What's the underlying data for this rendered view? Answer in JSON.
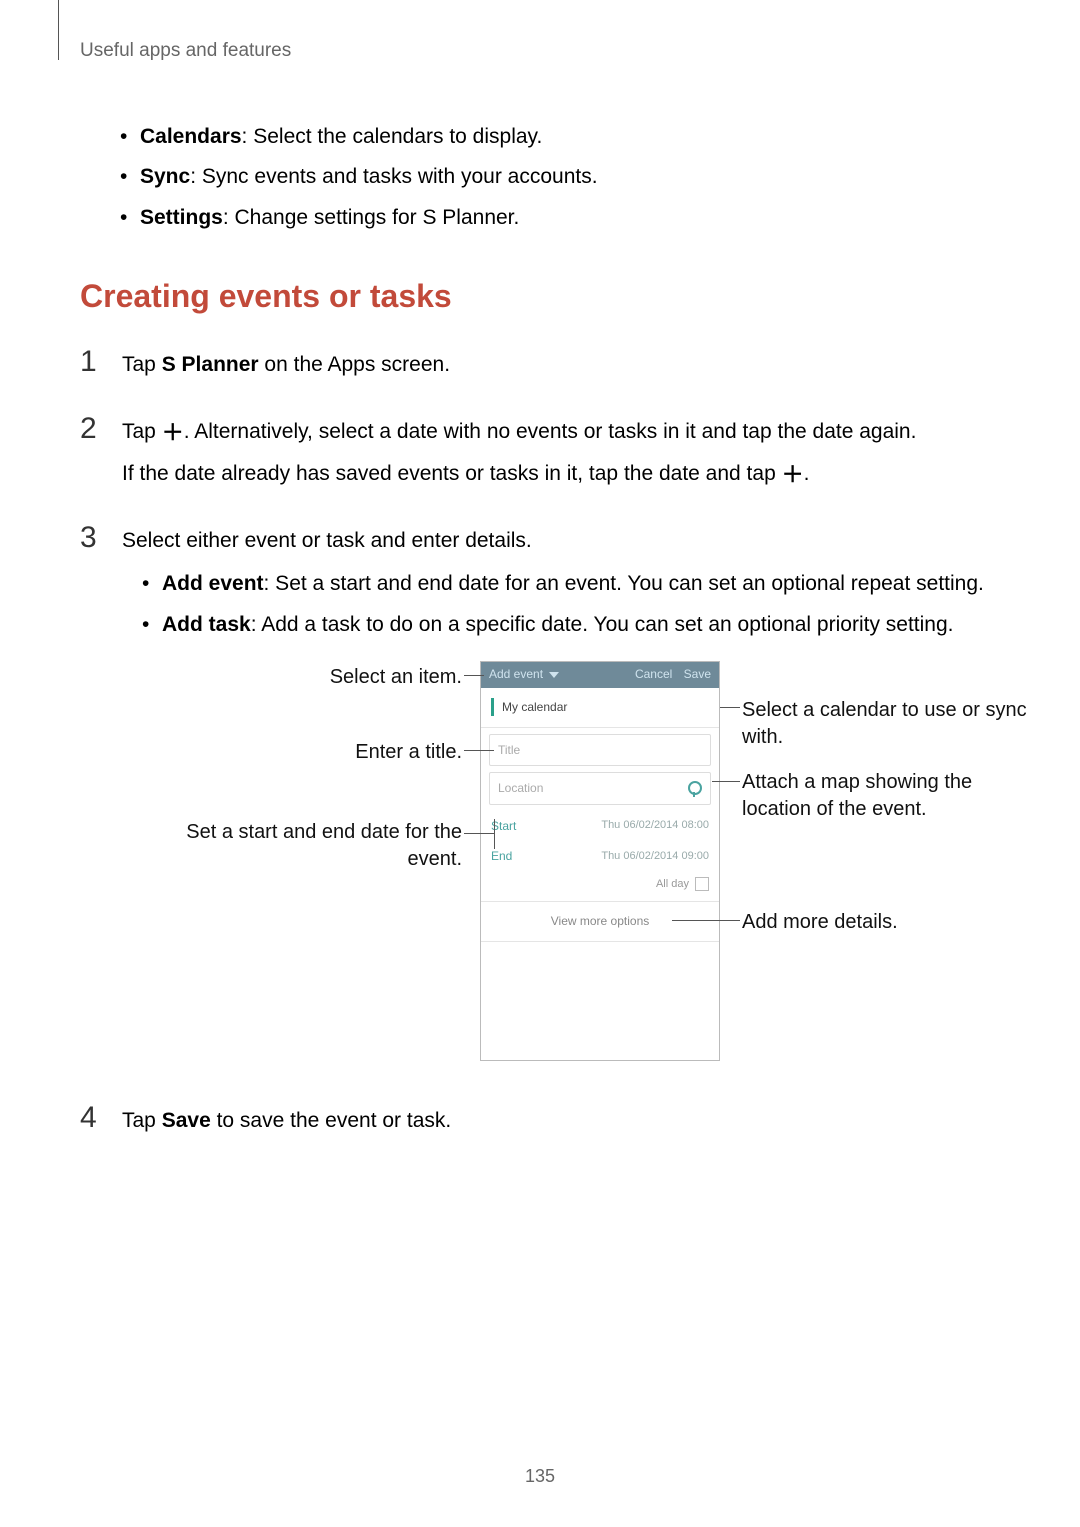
{
  "header": {
    "breadcrumb": "Useful apps and features"
  },
  "bullets_top": [
    {
      "term": "Calendars",
      "desc": ": Select the calendars to display."
    },
    {
      "term": "Sync",
      "desc": ": Sync events and tasks with your accounts."
    },
    {
      "term": "Settings",
      "desc": ": Change settings for S Planner."
    }
  ],
  "h2": "Creating events or tasks",
  "steps": {
    "s1": {
      "num": "1",
      "pre": "Tap ",
      "bold": "S Planner",
      "post": " on the Apps screen."
    },
    "s2": {
      "num": "2",
      "line1a": "Tap ",
      "line1b": ". Alternatively, select a date with no events or tasks in it and tap the date again.",
      "line2a": "If the date already has saved events or tasks in it, tap the date and tap ",
      "line2b": "."
    },
    "s3": {
      "num": "3",
      "intro": "Select either event or task and enter details.",
      "b1_term": "Add event",
      "b1_desc": ": Set a start and end date for an event. You can set an optional repeat setting.",
      "b2_term": "Add task",
      "b2_desc": ": Add a task to do on a specific date. You can set an optional priority setting."
    },
    "s4": {
      "num": "4",
      "pre": "Tap ",
      "bold": "Save",
      "post": " to save the event or task."
    }
  },
  "callouts": {
    "select_item": "Select an item.",
    "enter_title": "Enter a title.",
    "set_dates": "Set a start and end date for the event.",
    "select_calendar": "Select a calendar to use or sync with.",
    "attach_map": "Attach a map showing the location of the event.",
    "add_more": "Add more details."
  },
  "phone": {
    "header_left": "Add event",
    "header_cancel": "Cancel",
    "header_save": "Save",
    "my_calendar": "My calendar",
    "title_placeholder": "Title",
    "location_placeholder": "Location",
    "start_label": "Start",
    "start_value": "Thu 06/02/2014   08:00",
    "end_label": "End",
    "end_value": "Thu 06/02/2014   09:00",
    "all_day": "All day",
    "view_more": "View more options"
  },
  "page_number": "135"
}
